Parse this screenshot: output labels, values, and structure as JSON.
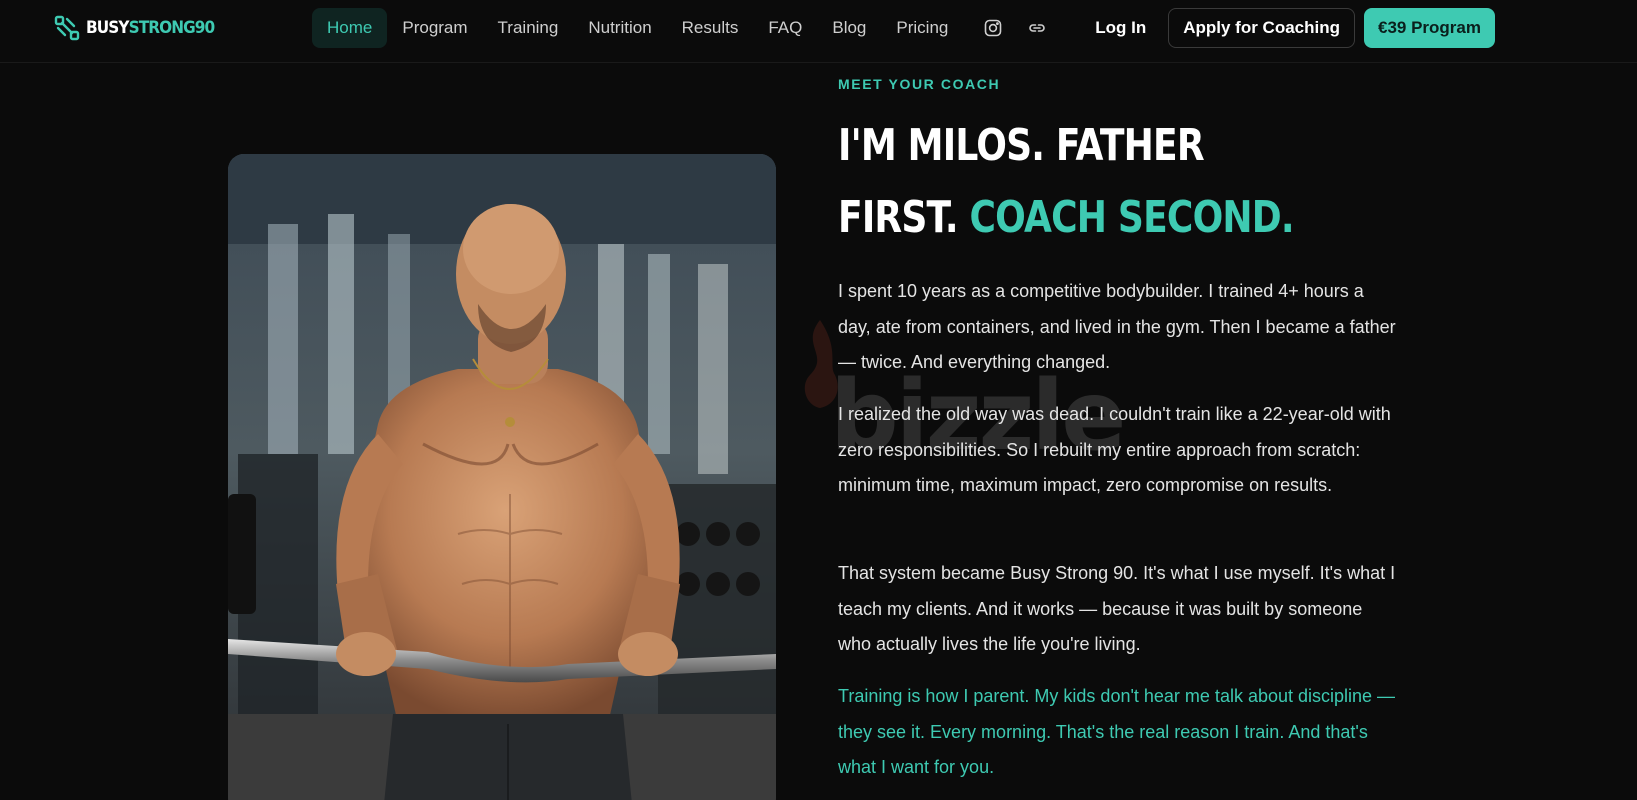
{
  "brand": {
    "logo_white": "BUSY",
    "logo_teal": "STRONG90",
    "accent": "#3ecab2",
    "background": "#0b0b0b"
  },
  "nav": {
    "links": [
      "Home",
      "Program",
      "Training",
      "Nutrition",
      "Results",
      "FAQ",
      "Blog",
      "Pricing"
    ],
    "active": "Home",
    "icons": [
      "instagram-icon",
      "link-icon"
    ],
    "login_label": "Log In",
    "apply_label": "Apply for Coaching",
    "program_label": "€39 Program"
  },
  "coach": {
    "eyebrow": "MEET YOUR COACH",
    "headline_line1": "I'M MILOS. FATHER",
    "headline_line2_white": "FIRST.",
    "headline_line2_teal": "COACH SECOND.",
    "paragraphs": [
      "I spent 10 years as a competitive bodybuilder. I trained 4+ hours a day, ate from containers, and lived in the gym. Then I became a father — twice. And everything changed.",
      "I realized the old way was dead. I couldn't train like a 22-year-old with zero responsibilities. So I rebuilt my entire approach from scratch: minimum time, maximum impact, zero compromise on results.",
      "That system became Busy Strong 90. It's what I use myself. It's what I teach my clients. And it works — because it was built by someone who actually lives the life you're living."
    ],
    "quote": "Training is how I parent. My kids don't hear me talk about discipline — they see it. Every morning. That's the real reason I train. And that's what I want for you."
  },
  "watermark": {
    "text": "bizzle"
  }
}
